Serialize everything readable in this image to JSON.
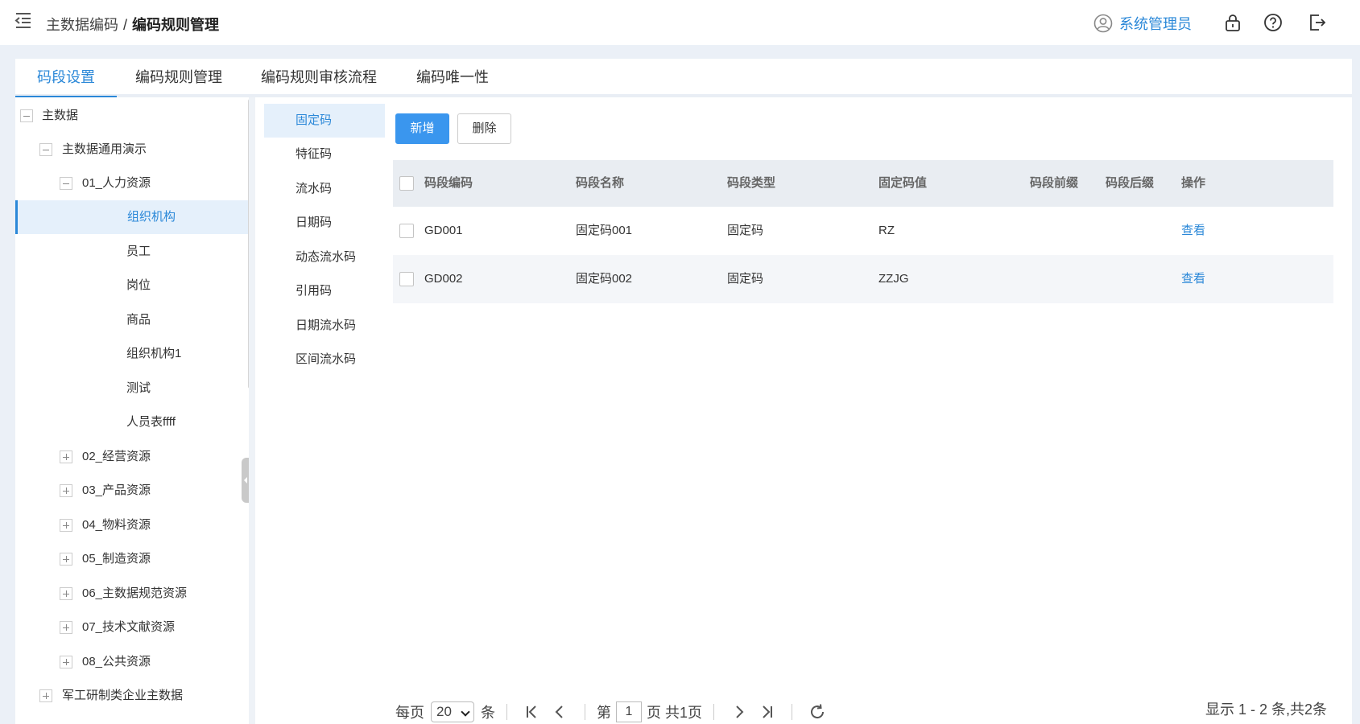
{
  "header": {
    "breadcrumb_parent": "主数据编码",
    "breadcrumb_sep": "/",
    "breadcrumb_current": "编码规则管理",
    "user_name": "系统管理员"
  },
  "tabs": [
    "码段设置",
    "编码规则管理",
    "编码规则审核流程",
    "编码唯一性"
  ],
  "tree": [
    {
      "label": "主数据",
      "level": 0,
      "toggle": "minus"
    },
    {
      "label": "主数据通用演示",
      "level": 1,
      "toggle": "minus"
    },
    {
      "label": "01_人力资源",
      "level": 2,
      "toggle": "minus"
    },
    {
      "label": "组织机构",
      "level": 3,
      "toggle": "none",
      "selected": true
    },
    {
      "label": "员工",
      "level": 3,
      "toggle": "none"
    },
    {
      "label": "岗位",
      "level": 3,
      "toggle": "none"
    },
    {
      "label": "商品",
      "level": 3,
      "toggle": "none"
    },
    {
      "label": "组织机构1",
      "level": 3,
      "toggle": "none"
    },
    {
      "label": "测试",
      "level": 3,
      "toggle": "none"
    },
    {
      "label": "人员表ffff",
      "level": 3,
      "toggle": "none"
    },
    {
      "label": "02_经营资源",
      "level": 2,
      "toggle": "plus"
    },
    {
      "label": "03_产品资源",
      "level": 2,
      "toggle": "plus"
    },
    {
      "label": "04_物料资源",
      "level": 2,
      "toggle": "plus"
    },
    {
      "label": "05_制造资源",
      "level": 2,
      "toggle": "plus"
    },
    {
      "label": "06_主数据规范资源",
      "level": 2,
      "toggle": "plus"
    },
    {
      "label": "07_技术文献资源",
      "level": 2,
      "toggle": "plus"
    },
    {
      "label": "08_公共资源",
      "level": 2,
      "toggle": "plus"
    },
    {
      "label": "军工研制类企业主数据",
      "level": 1,
      "toggle": "plus"
    }
  ],
  "segment_types": [
    "固定码",
    "特征码",
    "流水码",
    "日期码",
    "动态流水码",
    "引用码",
    "日期流水码",
    "区间流水码"
  ],
  "toolbar": {
    "add_label": "新增",
    "delete_label": "删除"
  },
  "grid": {
    "columns": [
      "码段编码",
      "码段名称",
      "码段类型",
      "固定码值",
      "码段前缀",
      "码段后缀",
      "操作"
    ],
    "rows": [
      {
        "code": "GD001",
        "name": "固定码001",
        "type": "固定码",
        "value": "RZ",
        "prefix": "",
        "suffix": "",
        "action": "查看"
      },
      {
        "code": "GD002",
        "name": "固定码002",
        "type": "固定码",
        "value": "ZZJG",
        "prefix": "",
        "suffix": "",
        "action": "查看"
      }
    ]
  },
  "pager": {
    "per_page_label": "每页",
    "page_size": "20",
    "unit": "条",
    "page_prefix": "第",
    "current_page": "1",
    "page_suffix": "页 共1页",
    "summary": "显示 1 - 2 条,共2条"
  },
  "colors": {
    "accent": "#2b88d8",
    "primary_button": "#3a96ee",
    "page_bg": "#ebf0f7"
  }
}
